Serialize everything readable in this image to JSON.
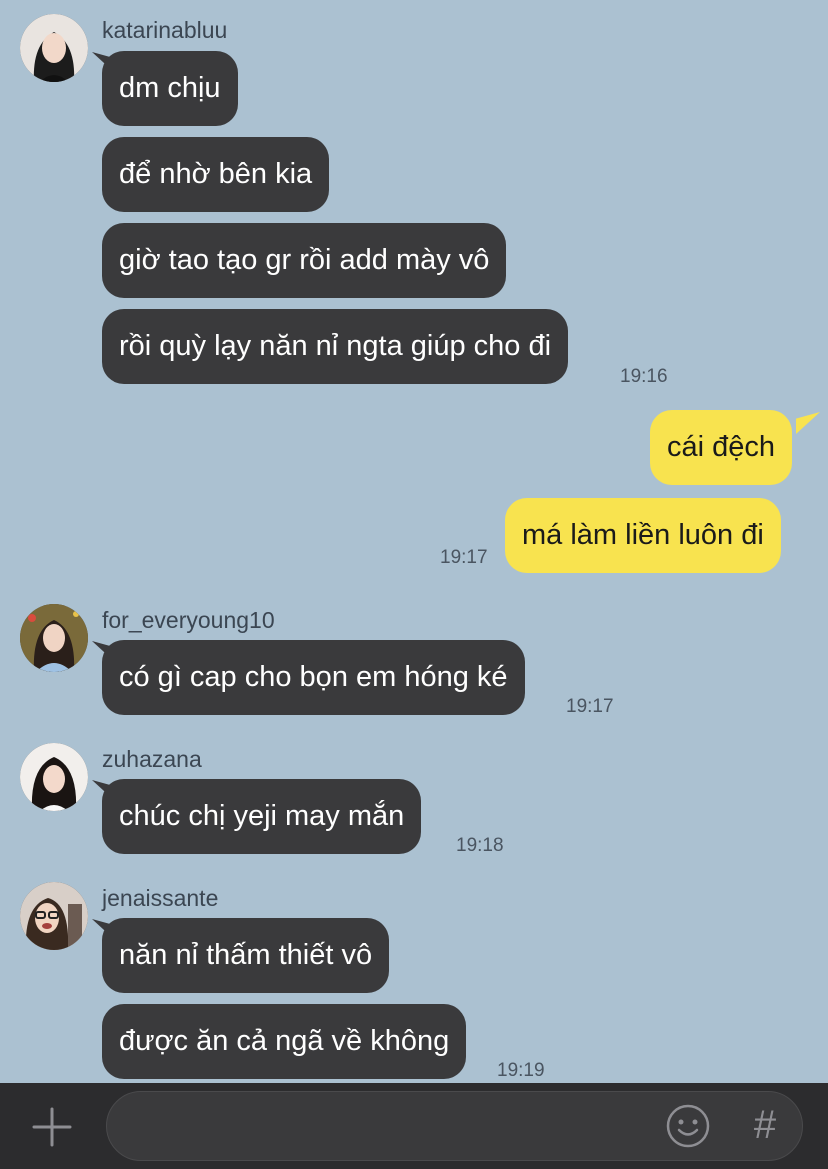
{
  "messages": [
    {
      "user": "katarinabluu",
      "lines": [
        "dm chịu",
        "để nhờ bên kia",
        "giờ tao tạo gr rồi add mày vô",
        "rồi quỳ lạy năn nỉ ngta giúp cho đi"
      ],
      "time": "19:16"
    },
    {
      "user": "me",
      "lines": [
        "cái đệch",
        "má làm liền luôn đi"
      ],
      "time": "19:17"
    },
    {
      "user": "for_everyoung10",
      "lines": [
        "có gì cap cho bọn em hóng ké"
      ],
      "time": "19:17"
    },
    {
      "user": "zuhazana",
      "lines": [
        "chúc chị yeji may mắn"
      ],
      "time": "19:18"
    },
    {
      "user": "jenaissante",
      "lines": [
        "năn nỉ thấm thiết vô",
        "được ăn cả ngã về không"
      ],
      "time": "19:19"
    }
  ],
  "composer": {
    "plus_icon": "plus-icon",
    "emoji_icon": "smiley-icon",
    "hash_label": "#"
  },
  "colors": {
    "background": "#abc1d1",
    "incoming_bubble": "#3a3a3c",
    "outgoing_bubble": "#f8e34f",
    "bottom_bar": "#2c2c2e"
  }
}
